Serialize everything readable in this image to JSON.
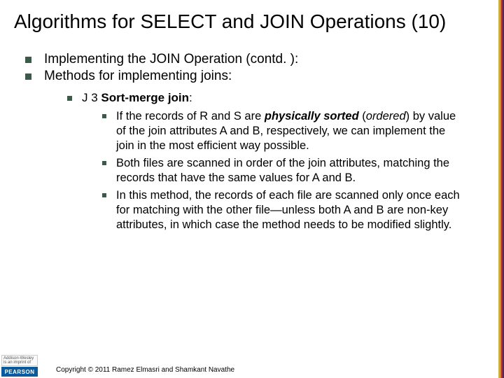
{
  "title": "Algorithms for SELECT and JOIN Operations (10)",
  "bullets": {
    "p1": "Implementing the JOIN Operation (contd. ):",
    "p2": "Methods for implementing joins:",
    "j3_label": "J 3",
    "j3_title": " Sort-merge join",
    "j3_colon": ":",
    "d1a": "If the records of R and S are ",
    "d1b": "physically sorted",
    "d1c": " (",
    "d1d": "ordered",
    "d1e": ") by value of the join attributes A and B, respectively, we can implement the join in the most efficient way possible.",
    "d2": "Both files are scanned in order of the join attributes, matching the records that have the same values for A and B.",
    "d3": "In this method, the records of each file are scanned only once each for matching with the other file—unless both A and B are non-key attributes, in which case the method needs to be modified slightly."
  },
  "footer": {
    "aw1": "Addison-Wesley",
    "aw2": "is an imprint of",
    "pearson": "PEARSON",
    "copyright": "Copyright © 2011 Ramez Elmasri and Shamkant Navathe"
  }
}
